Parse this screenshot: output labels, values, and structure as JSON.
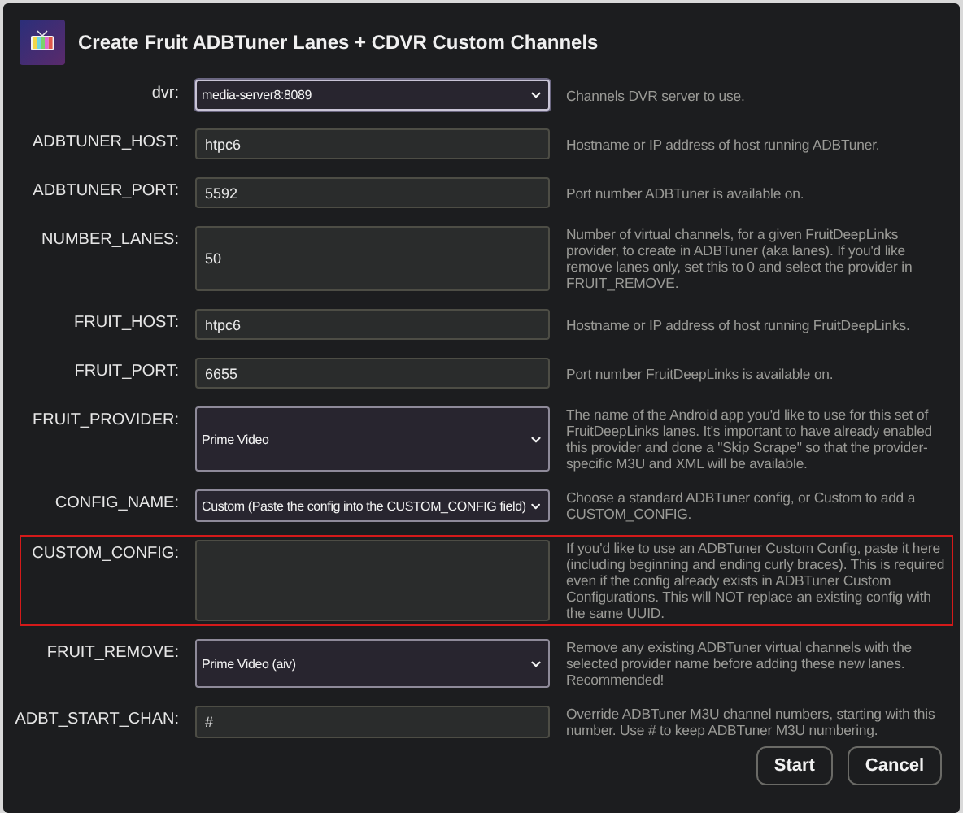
{
  "dialog": {
    "title": "Create Fruit ADBTuner Lanes + CDVR Custom Channels"
  },
  "fields": [
    {
      "label": "dvr:",
      "kind": "select",
      "value": "media-server8:8089",
      "highlighted": false,
      "description": "Channels DVR server to use."
    },
    {
      "label": "ADBTUNER_HOST:",
      "kind": "input",
      "value": "htpc6",
      "highlighted": false,
      "description": "Hostname or IP address of host running ADBTuner."
    },
    {
      "label": "ADBTUNER_PORT:",
      "kind": "input",
      "value": "5592",
      "highlighted": false,
      "description": "Port number ADBTuner is available on."
    },
    {
      "label": "NUMBER_LANES:",
      "kind": "input",
      "value": "50",
      "highlighted": false,
      "description": "Number of virtual channels, for a given FruitDeepLinks provider, to create in ADBTuner (aka lanes). If you'd like remove lanes only, set this to 0 and select the provider in FRUIT_REMOVE."
    },
    {
      "label": "FRUIT_HOST:",
      "kind": "input",
      "value": "htpc6",
      "highlighted": false,
      "description": "Hostname or IP address of host running FruitDeepLinks."
    },
    {
      "label": "FRUIT_PORT:",
      "kind": "input",
      "value": "6655",
      "highlighted": false,
      "description": "Port number FruitDeepLinks is available on."
    },
    {
      "label": "FRUIT_PROVIDER:",
      "kind": "select",
      "value": "Prime Video",
      "highlighted": false,
      "description": "The name of the Android app you'd like to use for this set of FruitDeepLinks lanes. It's important to have already enabled this provider and done a \"Skip Scrape\" so that the provider-specific M3U and XML will be available."
    },
    {
      "label": "CONFIG_NAME:",
      "kind": "select",
      "value": "Custom (Paste the config into the CUSTOM_CONFIG field)",
      "highlighted": false,
      "description": "Choose a standard ADBTuner config, or Custom to add a CUSTOM_CONFIG."
    },
    {
      "label": "CUSTOM_CONFIG:",
      "kind": "textarea",
      "highlighted": true,
      "description": "If you'd like to use an ADBTuner Custom Config, paste it here (including beginning and ending curly braces). This is required even if the config already exists in ADBTuner Custom Configurations. This will NOT replace an existing config with the same UUID."
    },
    {
      "label": "FRUIT_REMOVE:",
      "kind": "select",
      "value": "Prime Video (aiv)",
      "highlighted": false,
      "description": "Remove any existing ADBTuner virtual channels with the selected provider name before adding these new lanes. Recommended!"
    },
    {
      "label": "ADBT_START_CHAN:",
      "kind": "input",
      "value": "#",
      "highlighted": false,
      "description": "Override ADBTuner M3U channel numbers, starting with this number. Use # to keep ADBTuner M3U numbering."
    }
  ],
  "buttons": [
    "Start",
    "Cancel"
  ]
}
